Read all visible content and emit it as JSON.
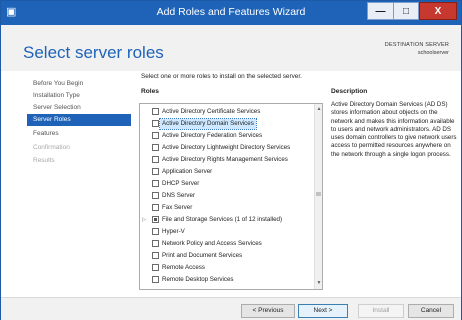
{
  "window": {
    "title": "Add Roles and Features Wizard",
    "icon": "server-manager-icon",
    "controls": {
      "minimize": "minimize-icon",
      "maximize": "maximize-icon",
      "close": "close-icon"
    }
  },
  "header": {
    "page_title": "Select server roles",
    "destination_label": "DESTINATION SERVER",
    "destination_value": "schoolserver"
  },
  "nav": {
    "items": [
      {
        "label": "Before You Begin",
        "state": "normal"
      },
      {
        "label": "Installation Type",
        "state": "normal"
      },
      {
        "label": "Server Selection",
        "state": "normal"
      },
      {
        "label": "Server Roles",
        "state": "active"
      },
      {
        "label": "Features",
        "state": "normal"
      },
      {
        "label": "Confirmation",
        "state": "disabled"
      },
      {
        "label": "Results",
        "state": "disabled"
      }
    ]
  },
  "main": {
    "instruction": "Select one or more roles to install on the selected server.",
    "roles_heading": "Roles",
    "description_heading": "Description",
    "description_text": "Active Directory Domain Services (AD DS) stores information about objects on the network and makes this information available to users and network administrators. AD DS uses domain controllers to give network users access to permitted resources anywhere on the network through a single logon process.",
    "roles": [
      {
        "label": "Active Directory Certificate Services",
        "checked": false,
        "selected": false,
        "expandable": false
      },
      {
        "label": "Active Directory Domain Services",
        "checked": false,
        "selected": true,
        "expandable": false
      },
      {
        "label": "Active Directory Federation Services",
        "checked": false,
        "selected": false,
        "expandable": false
      },
      {
        "label": "Active Directory Lightweight Directory Services",
        "checked": false,
        "selected": false,
        "expandable": false
      },
      {
        "label": "Active Directory Rights Management Services",
        "checked": false,
        "selected": false,
        "expandable": false
      },
      {
        "label": "Application Server",
        "checked": false,
        "selected": false,
        "expandable": false
      },
      {
        "label": "DHCP Server",
        "checked": false,
        "selected": false,
        "expandable": false
      },
      {
        "label": "DNS Server",
        "checked": false,
        "selected": false,
        "expandable": false
      },
      {
        "label": "Fax Server",
        "checked": false,
        "selected": false,
        "expandable": false
      },
      {
        "label": "File and Storage Services (1 of 12 installed)",
        "checked": "partial",
        "selected": false,
        "expandable": true
      },
      {
        "label": "Hyper-V",
        "checked": false,
        "selected": false,
        "expandable": false
      },
      {
        "label": "Network Policy and Access Services",
        "checked": false,
        "selected": false,
        "expandable": false
      },
      {
        "label": "Print and Document Services",
        "checked": false,
        "selected": false,
        "expandable": false
      },
      {
        "label": "Remote Access",
        "checked": false,
        "selected": false,
        "expandable": false
      },
      {
        "label": "Remote Desktop Services",
        "checked": false,
        "selected": false,
        "expandable": false
      }
    ],
    "scroll_arrows": {
      "up": "scroll-up-icon",
      "down": "scroll-down-icon"
    }
  },
  "footer": {
    "previous": "< Previous",
    "next": "Next >",
    "install": "Install",
    "cancel": "Cancel"
  }
}
